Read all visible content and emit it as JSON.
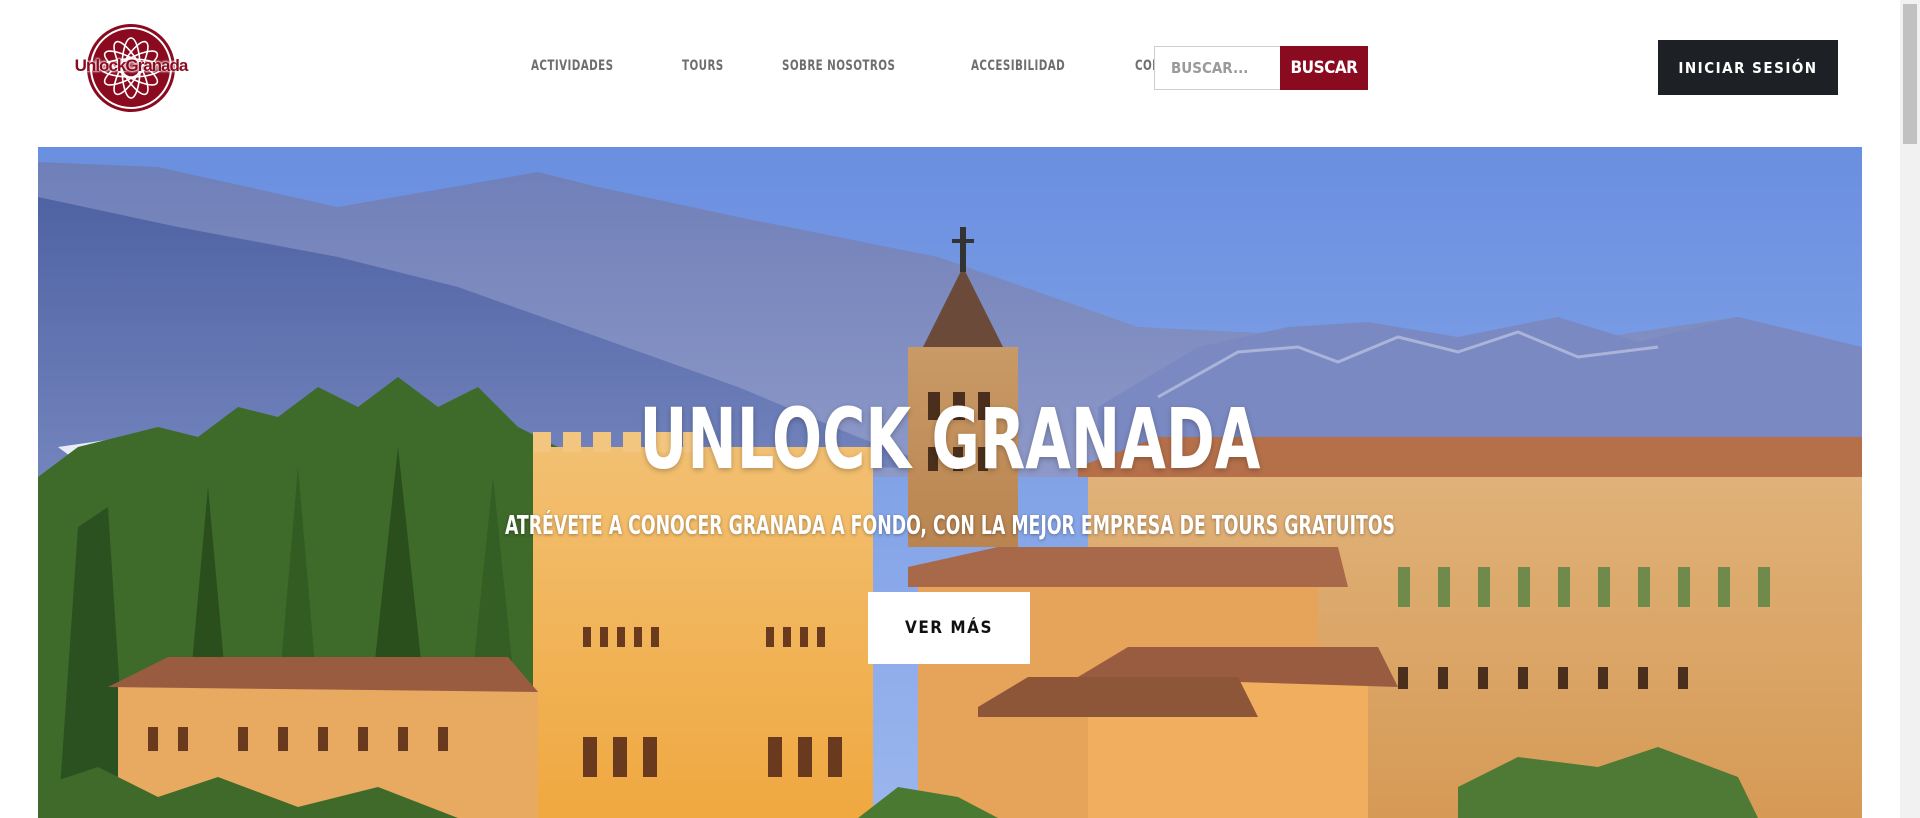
{
  "brand": {
    "logo_text": "UnlockGranada",
    "color": "#8a0a1f"
  },
  "nav": {
    "items": [
      {
        "label": "ACTIVIDADES"
      },
      {
        "label": "TOURS"
      },
      {
        "label": "SOBRE NOSOTROS"
      },
      {
        "label": "ACCESIBILIDAD"
      },
      {
        "label": "CONTACTO"
      }
    ]
  },
  "search": {
    "placeholder": "BUSCAR...",
    "button_label": "BUSCAR"
  },
  "header": {
    "login_label": "INICIAR SESIÓN"
  },
  "hero": {
    "title": "UNLOCK GRANADA",
    "subtitle": "ATRÉVETE A CONOCER GRANADA A FONDO, CON LA MEJOR EMPRESA DE TOURS GRATUITOS",
    "button_label": "VER MÁS",
    "image": "alhambra-landscape"
  },
  "colors": {
    "accent": "#8a0a1f",
    "dark": "#1d2024",
    "nav_text": "#6e6e6e"
  }
}
